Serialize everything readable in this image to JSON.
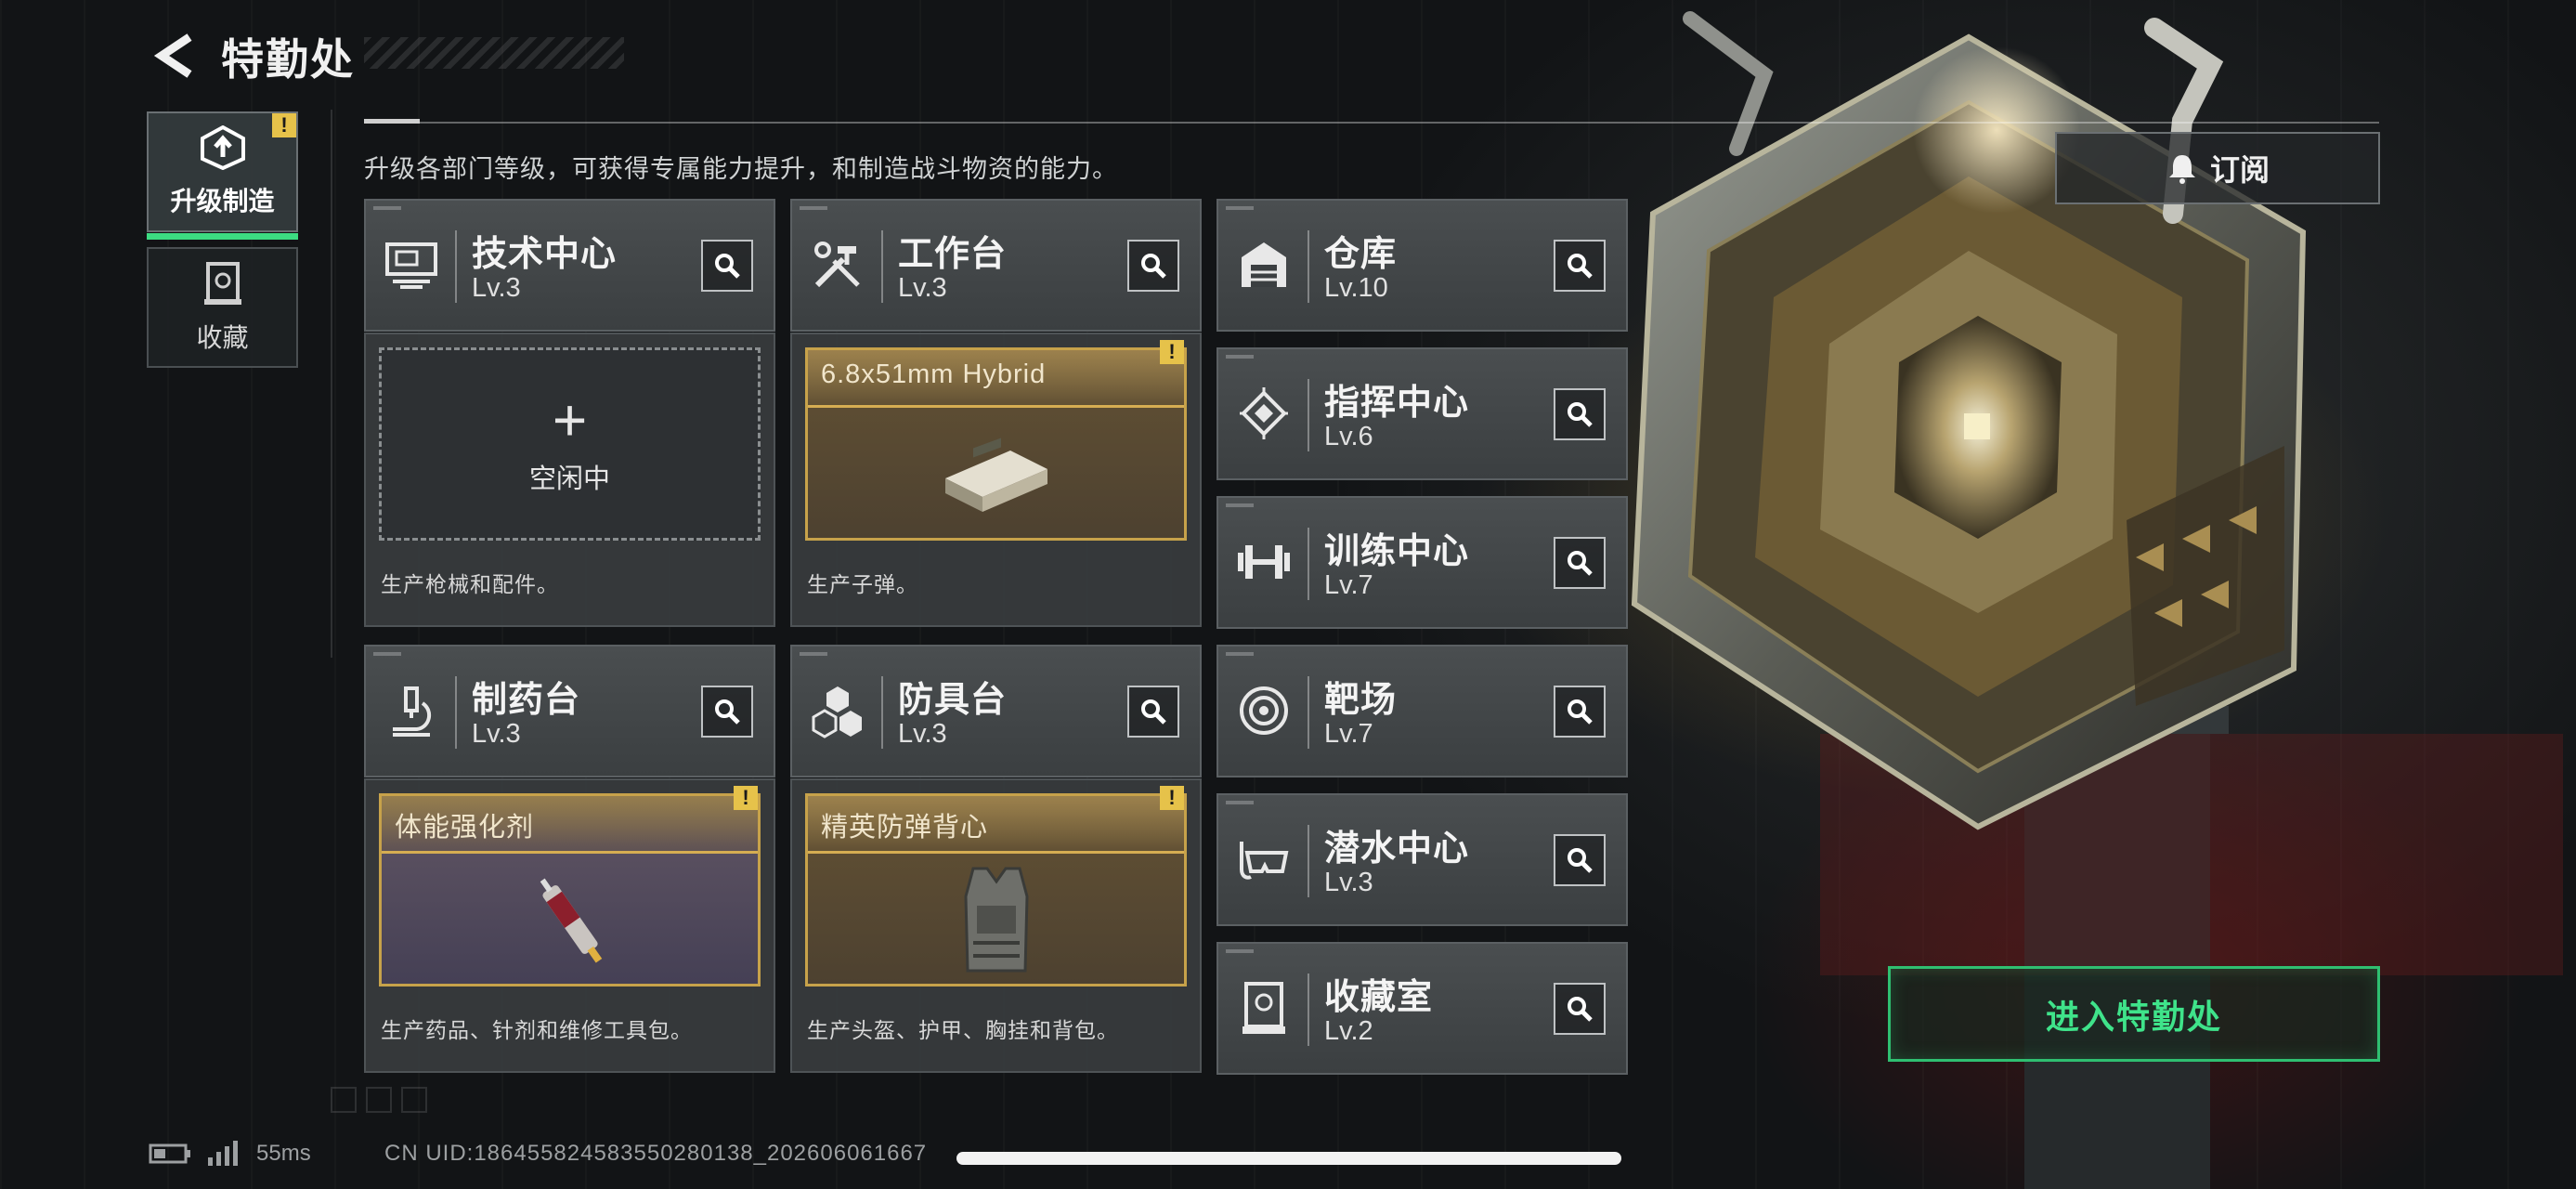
{
  "header": {
    "title": "特勤处",
    "back_icon": "back-chevron-icon"
  },
  "sidebar": {
    "tabs": [
      {
        "label": "升级制造",
        "icon": "upgrade-hex-icon",
        "active": true,
        "badge": "!"
      },
      {
        "label": "收藏",
        "icon": "collection-icon",
        "active": false
      }
    ]
  },
  "intro_text": "升级各部门等级，可获得专属能力提升，和制造战斗物资的能力。",
  "subscribe": {
    "label": "订阅",
    "icon": "bell-icon"
  },
  "facilities": {
    "tech": {
      "name": "技术中心",
      "level": "Lv.3",
      "icon": "computer-icon"
    },
    "workbench": {
      "name": "工作台",
      "level": "Lv.3",
      "icon": "tools-icon"
    },
    "pharma": {
      "name": "制药台",
      "level": "Lv.3",
      "icon": "microscope-icon"
    },
    "armor": {
      "name": "防具台",
      "level": "Lv.3",
      "icon": "cubes-icon"
    },
    "warehouse": {
      "name": "仓库",
      "level": "Lv.10",
      "icon": "warehouse-icon"
    },
    "command": {
      "name": "指挥中心",
      "level": "Lv.6",
      "icon": "chip-icon"
    },
    "training": {
      "name": "训练中心",
      "level": "Lv.7",
      "icon": "dumbbell-icon"
    },
    "range": {
      "name": "靶场",
      "level": "Lv.7",
      "icon": "target-icon"
    },
    "diving": {
      "name": "潜水中心",
      "level": "Lv.3",
      "icon": "diving-mask-icon"
    },
    "collection_room": {
      "name": "收藏室",
      "level": "Lv.2",
      "icon": "trophy-case-icon"
    }
  },
  "production": {
    "tech": {
      "status": "空闲中",
      "description": "生产枪械和配件。"
    },
    "workbench": {
      "item": "6.8x51mm Hybrid",
      "description": "生产子弹。",
      "alert": "!"
    },
    "pharma": {
      "item": "体能强化剂",
      "description": "生产药品、针剂和维修工具包。",
      "alert": "!"
    },
    "armor": {
      "item": "精英防弹背心",
      "description": "生产头盔、护甲、胸挂和背包。",
      "alert": "!"
    }
  },
  "enter_button": {
    "label": "进入特勤处"
  },
  "footer": {
    "ping": "55ms",
    "uid": "CN UID:18645582458355028013​8_20260606166​7"
  },
  "colors": {
    "accent_green": "#3fe38a",
    "alert_yellow": "#e6c24a",
    "item_gold": "#c7a24a"
  }
}
